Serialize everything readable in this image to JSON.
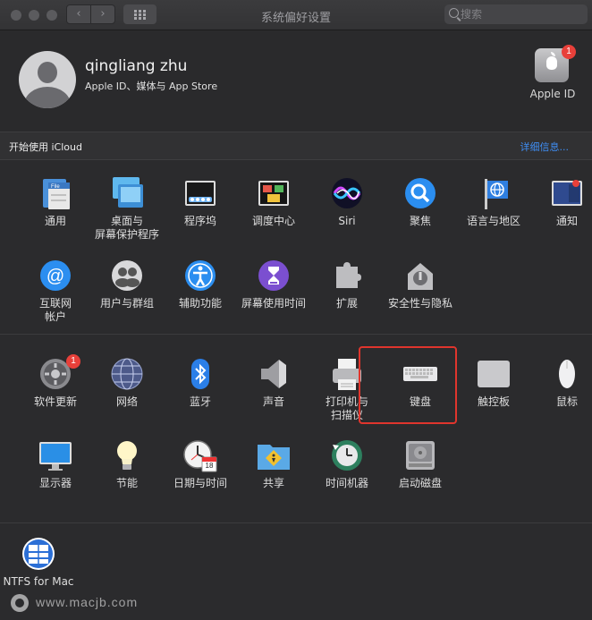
{
  "window": {
    "title": "系统偏好设置",
    "search_placeholder": "搜索"
  },
  "user": {
    "name": "qingliang zhu",
    "subtitle": "Apple ID、媒体与 App Store"
  },
  "apple_id": {
    "label": "Apple ID",
    "badge": "1"
  },
  "icloud": {
    "title": "开始使用 iCloud",
    "details": "详细信息..."
  },
  "section1": [
    {
      "label": "通用",
      "icon": "general-icon"
    },
    {
      "label": "桌面与\n屏幕保护程序",
      "icon": "desktop-screensaver-icon"
    },
    {
      "label": "程序坞",
      "icon": "dock-icon"
    },
    {
      "label": "调度中心",
      "icon": "mission-control-icon"
    },
    {
      "label": "Siri",
      "icon": "siri-icon"
    },
    {
      "label": "聚焦",
      "icon": "spotlight-icon"
    },
    {
      "label": "语言与地区",
      "icon": "language-region-icon"
    },
    {
      "label": "通知",
      "icon": "notifications-icon"
    },
    {
      "label": "互联网\n帐户",
      "icon": "internet-accounts-icon"
    },
    {
      "label": "用户与群组",
      "icon": "users-groups-icon"
    },
    {
      "label": "辅助功能",
      "icon": "accessibility-icon"
    },
    {
      "label": "屏幕使用时间",
      "icon": "screen-time-icon"
    },
    {
      "label": "扩展",
      "icon": "extensions-icon"
    },
    {
      "label": "安全性与隐私",
      "icon": "security-privacy-icon"
    }
  ],
  "section2": [
    {
      "label": "软件更新",
      "icon": "software-update-icon",
      "badge": "1"
    },
    {
      "label": "网络",
      "icon": "network-icon"
    },
    {
      "label": "蓝牙",
      "icon": "bluetooth-icon"
    },
    {
      "label": "声音",
      "icon": "sound-icon"
    },
    {
      "label": "打印机与\n扫描仪",
      "icon": "printers-scanners-icon"
    },
    {
      "label": "键盘",
      "icon": "keyboard-icon",
      "selected": true
    },
    {
      "label": "触控板",
      "icon": "trackpad-icon"
    },
    {
      "label": "鼠标",
      "icon": "mouse-icon"
    },
    {
      "label": "显示器",
      "icon": "displays-icon"
    },
    {
      "label": "节能",
      "icon": "energy-saver-icon"
    },
    {
      "label": "日期与时间",
      "icon": "date-time-icon",
      "date_num": "18"
    },
    {
      "label": "共享",
      "icon": "sharing-icon"
    },
    {
      "label": "时间机器",
      "icon": "time-machine-icon"
    },
    {
      "label": "启动磁盘",
      "icon": "startup-disk-icon"
    }
  ],
  "section3": [
    {
      "label": "NTFS for Mac",
      "icon": "ntfs-for-mac-icon"
    }
  ],
  "watermark": "www.macjb.com"
}
